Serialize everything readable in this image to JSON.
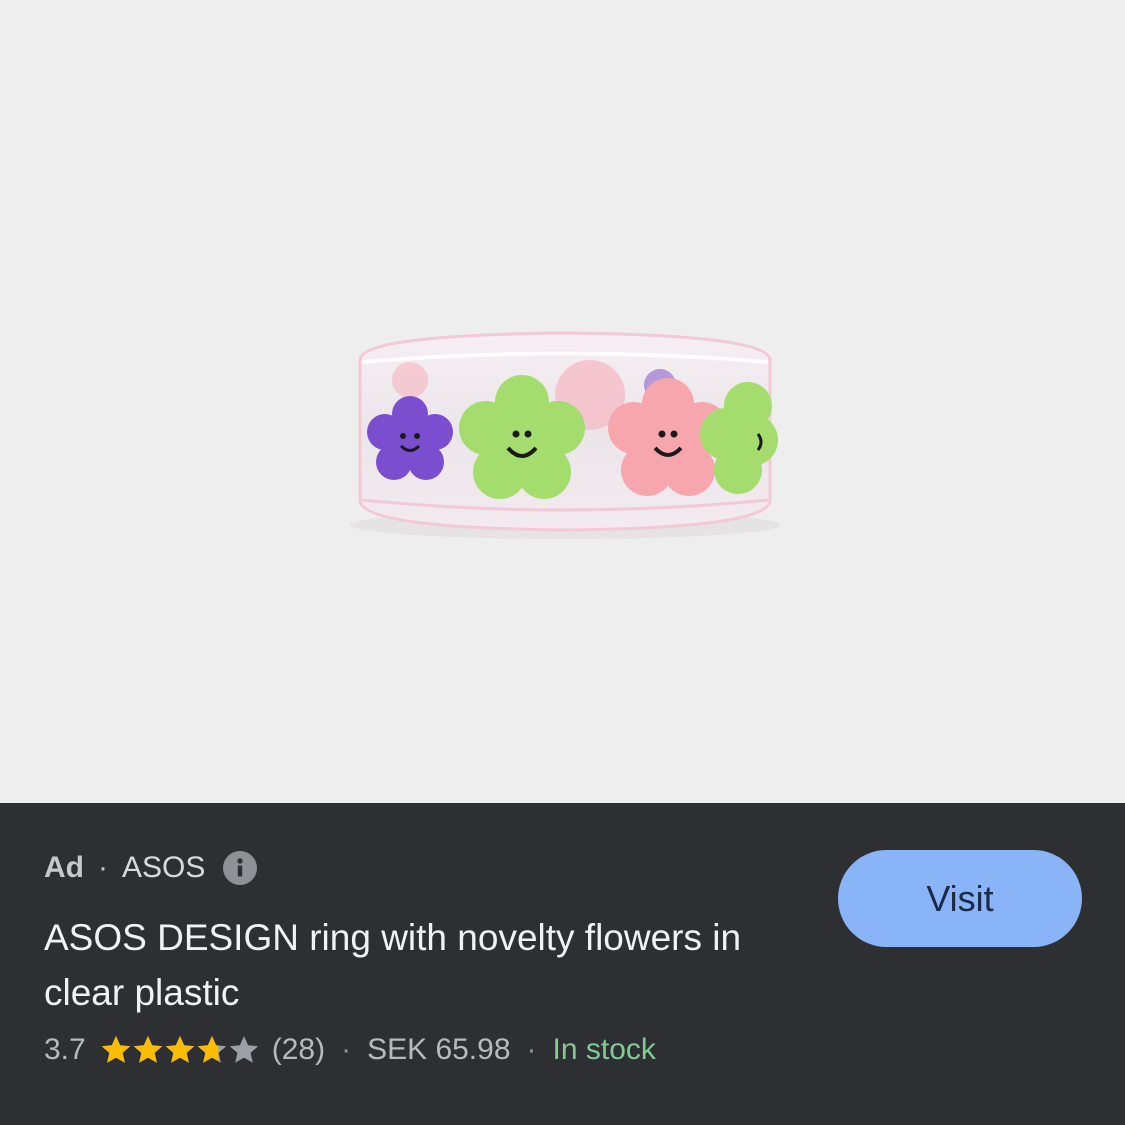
{
  "product_image": {
    "alt": "ASOS DESIGN ring with novelty flowers in clear plastic"
  },
  "ad": {
    "label": "Ad",
    "separator": "·",
    "advertiser": "ASOS",
    "info_icon": "info-icon"
  },
  "product": {
    "title": "ASOS DESIGN ring with novelty flowers in clear plastic",
    "rating": "3.7",
    "rating_value": 3.7,
    "rating_max": 5,
    "review_count": "(28)",
    "price": "SEK 65.98",
    "availability": "In stock"
  },
  "meta_separator": "·",
  "visit_button": {
    "label": "Visit"
  },
  "colors": {
    "panel_bg": "#2e2f33",
    "image_bg": "#efeeee",
    "button_bg": "#8ab4f8",
    "star_filled": "#fbbc04",
    "star_empty": "#9aa0a6",
    "stock_green": "#81c995"
  }
}
